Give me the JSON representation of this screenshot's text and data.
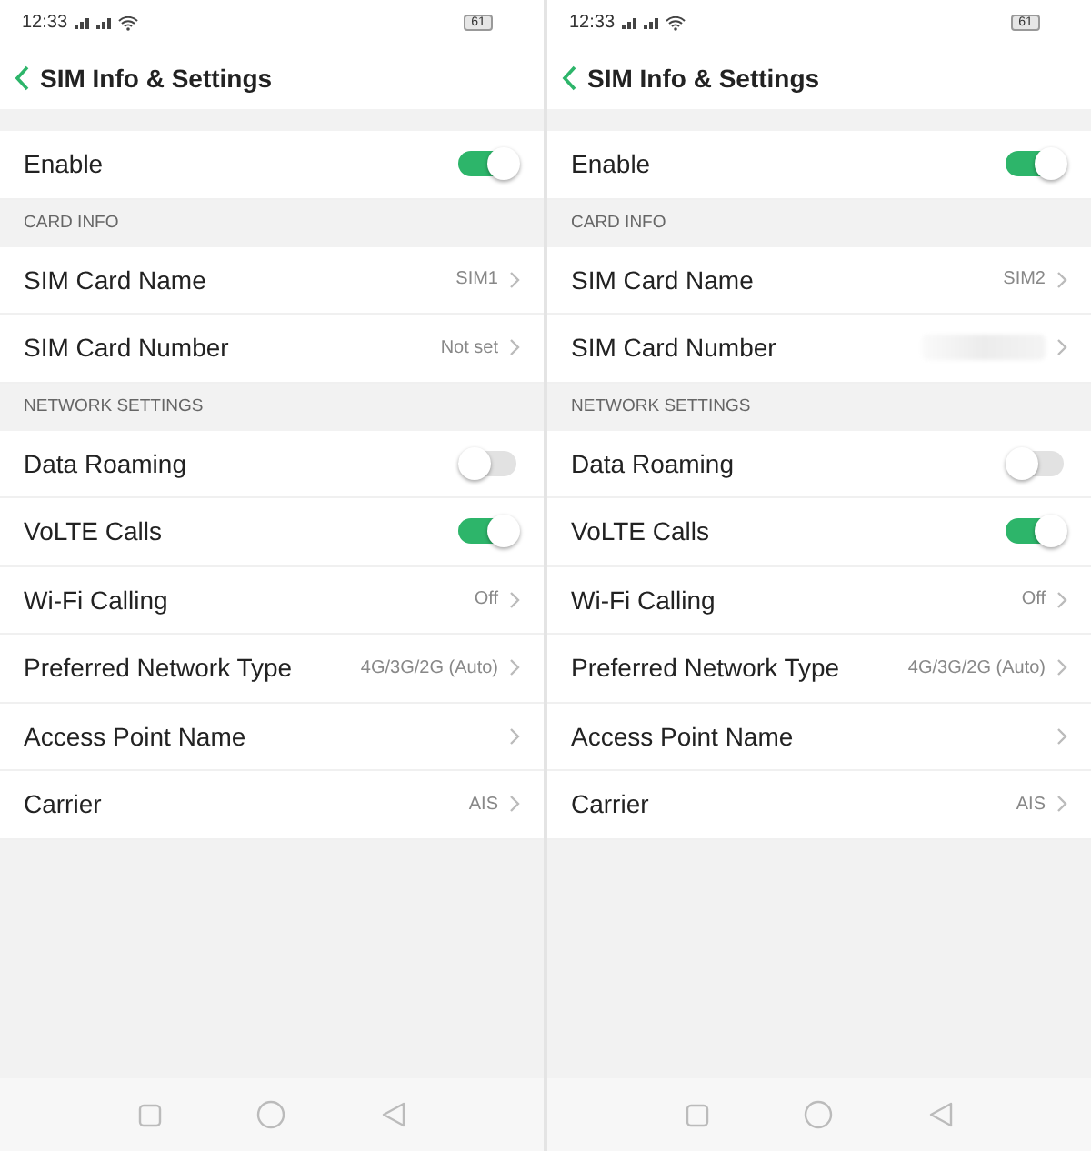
{
  "screens": [
    {
      "status_bar": {
        "time": "12:33",
        "battery": "61"
      },
      "title": "SIM Info & Settings",
      "sections": [
        {
          "rows": [
            {
              "kind": "toggle",
              "label": "Enable",
              "on": true
            }
          ]
        },
        {
          "header": "CARD INFO",
          "rows": [
            {
              "kind": "link",
              "label": "SIM Card Name",
              "value": "SIM1"
            },
            {
              "kind": "link",
              "label": "SIM Card Number",
              "value": "Not set"
            }
          ]
        },
        {
          "header": "NETWORK SETTINGS",
          "rows": [
            {
              "kind": "toggle",
              "label": "Data Roaming",
              "on": false
            },
            {
              "kind": "toggle",
              "label": "VoLTE Calls",
              "on": true
            },
            {
              "kind": "link",
              "label": "Wi-Fi Calling",
              "value": "Off"
            },
            {
              "kind": "link",
              "label": "Preferred Network Type",
              "value": "4G/3G/2G (Auto)"
            },
            {
              "kind": "link",
              "label": "Access Point Name"
            },
            {
              "kind": "link",
              "label": "Carrier",
              "value": "AIS"
            }
          ]
        }
      ]
    },
    {
      "status_bar": {
        "time": "12:33",
        "battery": "61"
      },
      "title": "SIM Info & Settings",
      "sections": [
        {
          "rows": [
            {
              "kind": "toggle",
              "label": "Enable",
              "on": true
            }
          ]
        },
        {
          "header": "CARD INFO",
          "rows": [
            {
              "kind": "link",
              "label": "SIM Card Name",
              "value": "SIM2"
            },
            {
              "kind": "blurred",
              "label": "SIM Card Number"
            }
          ]
        },
        {
          "header": "NETWORK SETTINGS",
          "rows": [
            {
              "kind": "toggle",
              "label": "Data Roaming",
              "on": false
            },
            {
              "kind": "toggle",
              "label": "VoLTE Calls",
              "on": true
            },
            {
              "kind": "link",
              "label": "Wi-Fi Calling",
              "value": "Off"
            },
            {
              "kind": "link",
              "label": "Preferred Network Type",
              "value": "4G/3G/2G (Auto)"
            },
            {
              "kind": "link",
              "label": "Access Point Name"
            },
            {
              "kind": "link",
              "label": "Carrier",
              "value": "AIS"
            }
          ]
        }
      ]
    }
  ]
}
